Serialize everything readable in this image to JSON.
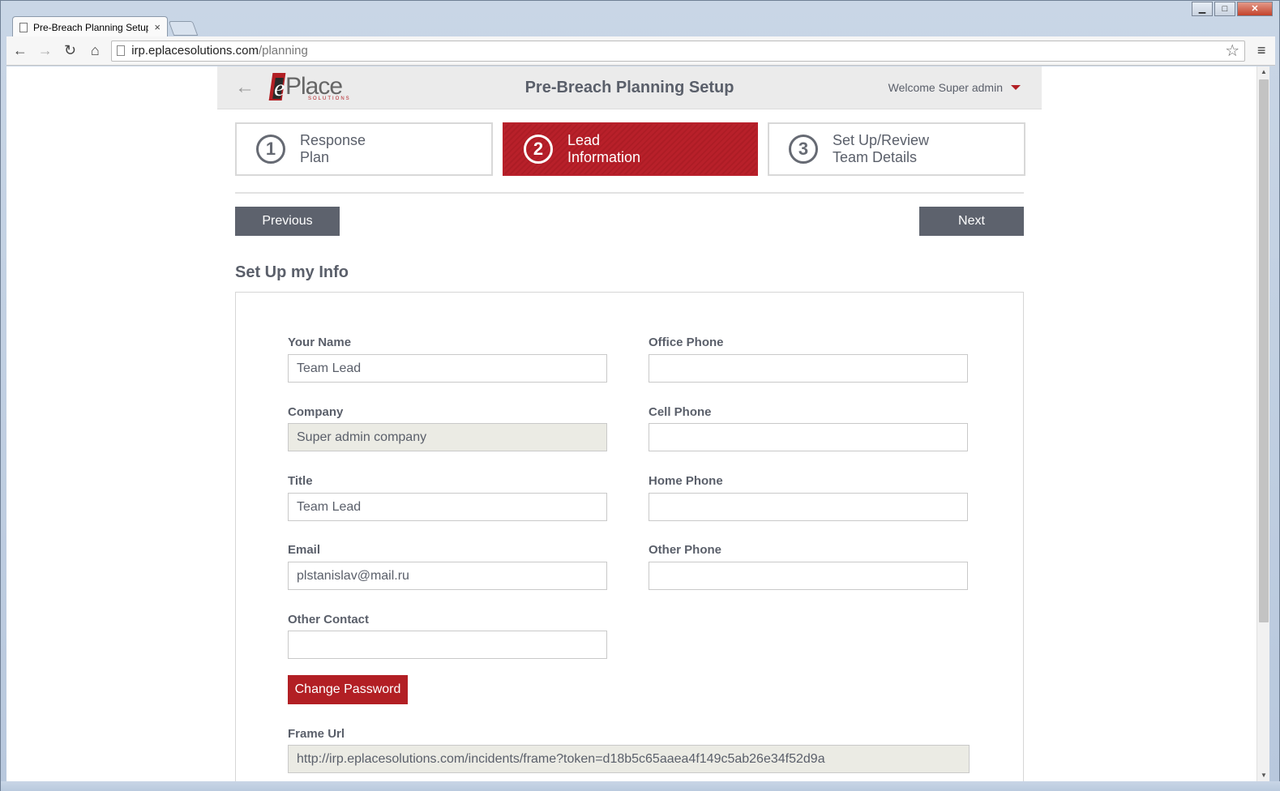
{
  "browser": {
    "tab_title": "Pre-Breach Planning Setup",
    "tab_close": "×",
    "url_host": "irp.eplacesolutions.com",
    "url_path": "/planning",
    "window_buttons": {
      "minimize": "▁",
      "maximize": "□",
      "close": "✕"
    },
    "nav": {
      "back": "←",
      "forward": "→",
      "reload": "↻",
      "home": "⌂",
      "star": "☆",
      "menu": "≡"
    }
  },
  "header": {
    "back": "←",
    "logo_text": "Place",
    "logo_e": "e",
    "logo_sub": "SOLUTIONS",
    "title": "Pre-Breach Planning Setup",
    "welcome": "Welcome Super admin"
  },
  "steps": [
    {
      "number": "1",
      "line1": "Response",
      "line2": "Plan",
      "active": false
    },
    {
      "number": "2",
      "line1": "Lead",
      "line2": "Information",
      "active": true
    },
    {
      "number": "3",
      "line1": "Set Up/Review",
      "line2": "Team Details",
      "active": false
    }
  ],
  "buttons": {
    "previous": "Previous",
    "next": "Next",
    "change_password": "Change Password"
  },
  "section_title": "Set Up my Info",
  "form": {
    "your_name": {
      "label": "Your Name",
      "value": "Team Lead"
    },
    "company": {
      "label": "Company",
      "value": "Super admin company"
    },
    "title": {
      "label": "Title",
      "value": "Team Lead"
    },
    "email": {
      "label": "Email",
      "value": "plstanislav@mail.ru"
    },
    "other_contact": {
      "label": "Other Contact",
      "value": ""
    },
    "office_phone": {
      "label": "Office Phone",
      "value": ""
    },
    "cell_phone": {
      "label": "Cell Phone",
      "value": ""
    },
    "home_phone": {
      "label": "Home Phone",
      "value": ""
    },
    "other_phone": {
      "label": "Other Phone",
      "value": ""
    },
    "frame_url": {
      "label": "Frame Url",
      "value": "http://irp.eplacesolutions.com/incidents/frame?token=d18b5c65aaea4f149c5ab26e34f52d9a"
    }
  },
  "colors": {
    "accent": "#b21f24",
    "button_dark": "#5d626d",
    "text": "#5a5f6a"
  }
}
